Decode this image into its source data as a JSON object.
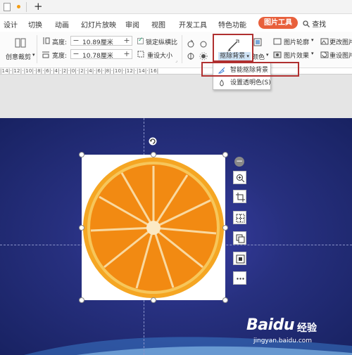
{
  "menu": {
    "items": [
      "设计",
      "切换",
      "动画",
      "幻灯片放映",
      "审阅",
      "视图",
      "开发工具",
      "特色功能"
    ],
    "picture_tools_tab": "图片工具",
    "search": "查找"
  },
  "toolbar": {
    "creative_crop": "创意裁剪",
    "height_label": "高度:",
    "height_value": "10.89厘米",
    "width_label": "宽度:",
    "width_value": "10.78厘米",
    "minus": "−",
    "plus": "+",
    "lock_ratio": "锁定纵横比",
    "reset_size": "重设大小",
    "remove_background": "抠除背景",
    "color": "颜色",
    "picture_outline": "图片轮廓",
    "picture_effect": "图片效果",
    "change_picture": "更改图片",
    "reset_picture": "重设图片"
  },
  "ruler": {
    "numbers": "|14|·|12|·|10|·|8|·|6|·|4|·|2|·|0|·|2|·|4|·|6|·|8|·|10|·|12|·|14|·|16|"
  },
  "dropdown": {
    "items": [
      {
        "label": "智能抠除背景",
        "icon": "smart-remove-icon"
      },
      {
        "label": "设置透明色(S)",
        "icon": "transparent-color-icon"
      }
    ]
  },
  "watermark": {
    "brand": "Baidu",
    "sub": "经验",
    "url": "jingyan.baidu.com"
  },
  "colors": {
    "accent_tab": "#e8603c",
    "highlight_box": "#b03030",
    "slide_bg": "#27307f"
  }
}
